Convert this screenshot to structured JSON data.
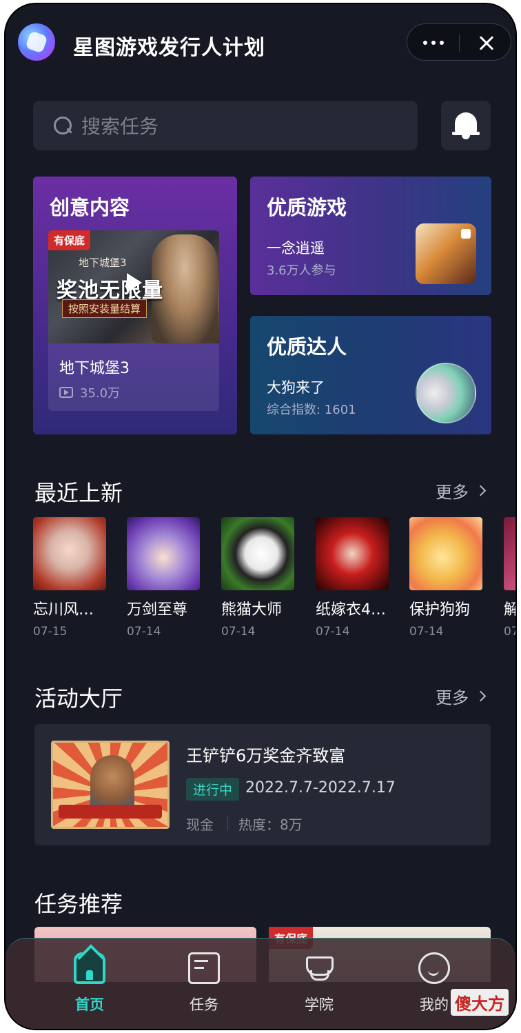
{
  "header": {
    "app_title": "星图游戏发行人计划",
    "more_icon": "ellipsis-icon",
    "close_icon": "close-icon"
  },
  "search": {
    "placeholder": "搜索任务",
    "icon": "search-icon"
  },
  "notifications": {
    "icon": "bell-icon"
  },
  "featured": {
    "creative": {
      "title": "创意内容",
      "badge": "有保底",
      "thumb_small": "地下城堡3",
      "thumb_big": "奖池无限量",
      "thumb_sub": "按照安装量结算",
      "video_title": "地下城堡3",
      "views": "35.0万"
    },
    "game": {
      "title": "优质游戏",
      "name": "一念逍遥",
      "meta": "3.6万人参与"
    },
    "star": {
      "title": "优质达人",
      "name": "大狗来了",
      "meta": "综合指数: 1601"
    }
  },
  "recent": {
    "title": "最近上新",
    "more": "更多",
    "items": [
      {
        "name": "忘川风…",
        "date": "07-15"
      },
      {
        "name": "万剑至尊",
        "date": "07-14"
      },
      {
        "name": "熊猫大师",
        "date": "07-14"
      },
      {
        "name": "纸嫁衣4…",
        "date": "07-14"
      },
      {
        "name": "保护狗狗",
        "date": "07-14"
      },
      {
        "name": "解",
        "date": "07"
      }
    ]
  },
  "events": {
    "title": "活动大厅",
    "more": "更多",
    "card": {
      "title": "王铲铲6万奖金齐致富",
      "status": "进行中",
      "date_range": "2022.7.7-2022.7.17",
      "type": "现金",
      "heat": "热度：8万"
    }
  },
  "tasks": {
    "title": "任务推荐",
    "badge": "有保底"
  },
  "tabbar": {
    "items": [
      {
        "label": "首页",
        "icon": "home-icon",
        "active": true
      },
      {
        "label": "任务",
        "icon": "task-icon",
        "active": false
      },
      {
        "label": "学院",
        "icon": "graduation-cap-icon",
        "active": false
      },
      {
        "label": "我的",
        "icon": "smiley-icon",
        "active": false
      }
    ]
  },
  "watermark": "傻大方",
  "colors": {
    "accent": "#2fd8c8",
    "background": "#161823",
    "card": "#262935"
  }
}
